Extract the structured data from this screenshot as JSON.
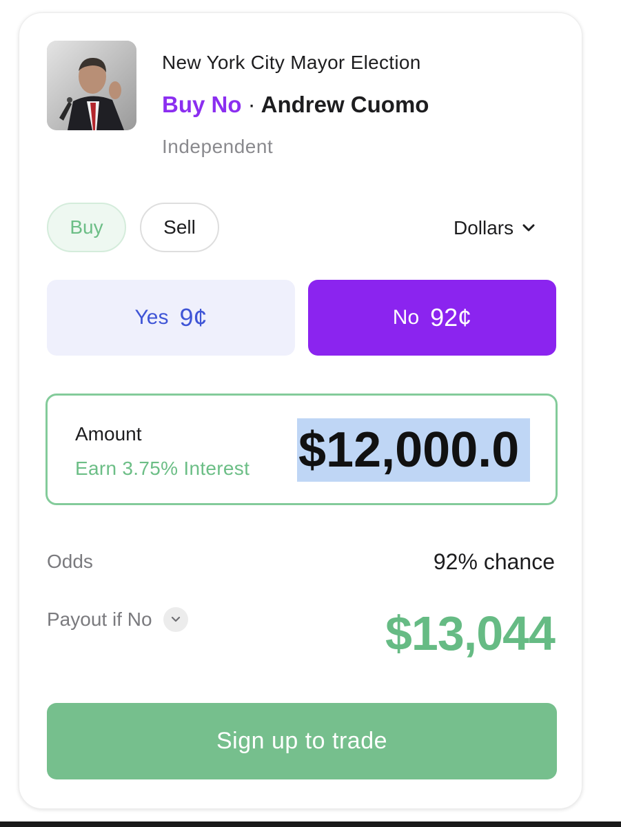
{
  "market": {
    "title": "New York City Mayor Election",
    "action": "Buy No",
    "separator": "·",
    "candidate": "Andrew Cuomo",
    "party": "Independent",
    "avatar_icon": "candidate-photo"
  },
  "trade_side": {
    "buy_label": "Buy",
    "sell_label": "Sell",
    "selected": "Buy"
  },
  "currency": {
    "selected": "Dollars",
    "icon": "chevron-down-icon"
  },
  "outcomes": {
    "yes": {
      "label": "Yes",
      "price": "9¢"
    },
    "no": {
      "label": "No",
      "price": "92¢"
    },
    "selected": "No"
  },
  "amount": {
    "label": "Amount",
    "interest_note": "Earn 3.75% Interest",
    "value": "$12,000.0"
  },
  "summary": {
    "odds_label": "Odds",
    "odds_value": "92% chance",
    "payout_label": "Payout if No",
    "payout_value": "$13,044"
  },
  "cta": {
    "label": "Sign up to trade"
  },
  "colors": {
    "accent_purple": "#8b24ef",
    "accent_green": "#6cbe86",
    "cta_green": "#76bf8d",
    "yes_blue": "#3f55d6"
  }
}
